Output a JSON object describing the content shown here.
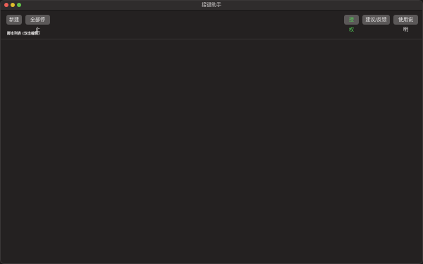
{
  "window": {
    "title": "接键助手"
  },
  "toolbar": {
    "left_buttons": [
      {
        "label": "新建"
      },
      {
        "label": "全部停止"
      }
    ],
    "right_buttons": [
      {
        "label": "授权",
        "color": "#58d35a"
      },
      {
        "label": "建议/反馈"
      },
      {
        "label": "使用说明"
      }
    ]
  },
  "script_list": {
    "header": "脚本列表 (双击编辑)",
    "items": []
  },
  "colors": {
    "background": "#242121",
    "titlebar": "#2f2c2c",
    "button": "#5b5858",
    "accent_green": "#58d35a"
  }
}
